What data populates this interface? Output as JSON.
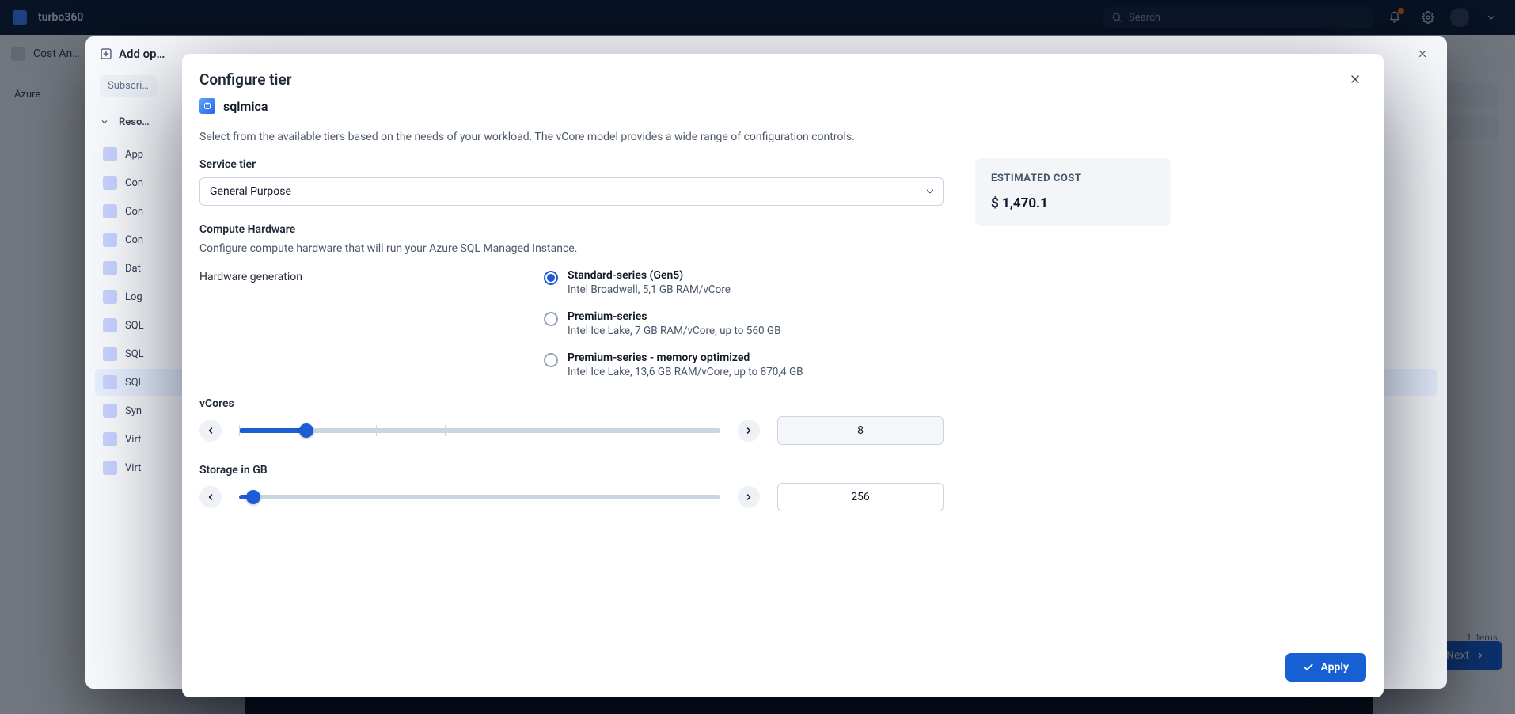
{
  "brand": "turbo360",
  "search_placeholder": "Search",
  "breadcrumb": "Cost An…",
  "outer_dialog": {
    "title": "Add op…",
    "tab1": "Subscri…",
    "group": "Reso…"
  },
  "rail": {
    "items": [
      "Azure",
      "App",
      "Con",
      "Con",
      "Con",
      "Dat",
      "Log",
      "SQL",
      "SQL",
      "SQL",
      "Syn",
      "Virt",
      "Virt"
    ]
  },
  "dialog": {
    "title": "Configure tier",
    "resource": "sqlmica",
    "description": "Select from the available tiers based on the needs of your workload. The vCore model provides a wide range of configuration controls.",
    "service_tier_label": "Service tier",
    "service_tier_value": "General Purpose",
    "compute_hw_title": "Compute Hardware",
    "compute_hw_desc": "Configure compute hardware that will run your Azure SQL Managed Instance.",
    "hw_gen_label": "Hardware generation",
    "radio": {
      "0": {
        "title": "Standard-series (Gen5)",
        "desc": "Intel Broadwell, 5,1 GB RAM/vCore"
      },
      "1": {
        "title": "Premium-series",
        "desc": "Intel Ice Lake, 7 GB RAM/vCore, up to 560 GB"
      },
      "2": {
        "title": "Premium-series - memory optimized",
        "desc": "Intel Ice Lake, 13,6 GB RAM/vCore, up to 870,4 GB"
      }
    },
    "vcores_label": "vCores",
    "vcores_value": "8",
    "storage_label": "Storage in GB",
    "storage_value": "256",
    "cost_title": "ESTIMATED COST",
    "cost_value": "$ 1,470.1",
    "apply_label": "Apply",
    "next_label": "Next"
  },
  "right_info": {
    "items_text": "1 items"
  }
}
